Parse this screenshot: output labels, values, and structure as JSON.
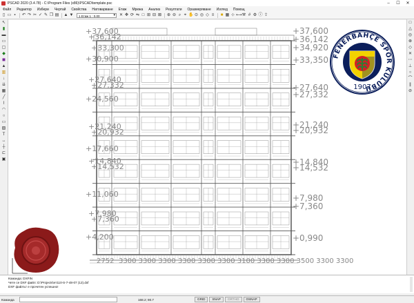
{
  "window": {
    "title": "PSCAD 2020 (3.4.78) - C:\\Program Files (x86)\\PSCAD\\template.psc",
    "controls": [
      "–",
      "☐",
      "✕"
    ]
  },
  "menu": [
    "Файл",
    "Редактор",
    "Избери",
    "Чертай",
    "Свойства",
    "Натоварване",
    "Етаж",
    "Мрежа",
    "Анализ",
    "Резултати",
    "Оразмеряване",
    "Изглед",
    "Помощ"
  ],
  "toolbar": {
    "layer_select": "1 Етаж 1 : 0.00"
  },
  "drawing": {
    "left_levels": [
      "+37,600",
      "+36,142",
      "+33,300",
      "+30,900",
      "+27,640",
      "+27,332",
      "+24,560",
      "+21,240",
      "+20,932",
      "+17,660",
      "+14,840",
      "+14,532",
      "+11,060",
      "+7,980",
      "+7,360",
      "+4,200"
    ],
    "right_levels": [
      "+37,600",
      "+36,142",
      "+34,920",
      "+33,350",
      "+27,640",
      "+27,332",
      "+21,240",
      "+20,932",
      "+14,840",
      "+14,532",
      "+7,980",
      "+7,360",
      "+0,990"
    ],
    "bottom_dims": "3300 3300 3300 3300 3300 3300 3100 3300 3300 3500 3300 3300",
    "bottom_left": "2752",
    "logo": {
      "ring_text": "FENERBAHÇE SPOR KULÜBÜ",
      "year": "1907",
      "colors": {
        "navy": "#0b1e5b",
        "yellow": "#f2d200",
        "red": "#d31f26",
        "green": "#2e7d32"
      }
    },
    "seal_color": "#8b1a1a"
  },
  "command_area": {
    "lines": [
      "Команда: DXFIN",
      "Чете се DXF файл: D:\\Projects\\ет110-S-7-48-07 (12).dxf",
      "DXF файлът е прочетен успешно!"
    ]
  },
  "status": {
    "command_label": "Команда",
    "coords": "168.2; 90.7",
    "buttons": [
      {
        "label": "GRID",
        "on": true
      },
      {
        "label": "SNAP",
        "on": true
      },
      {
        "label": "ORTHO",
        "on": false
      },
      {
        "label": "OSNAP",
        "on": true
      }
    ]
  }
}
